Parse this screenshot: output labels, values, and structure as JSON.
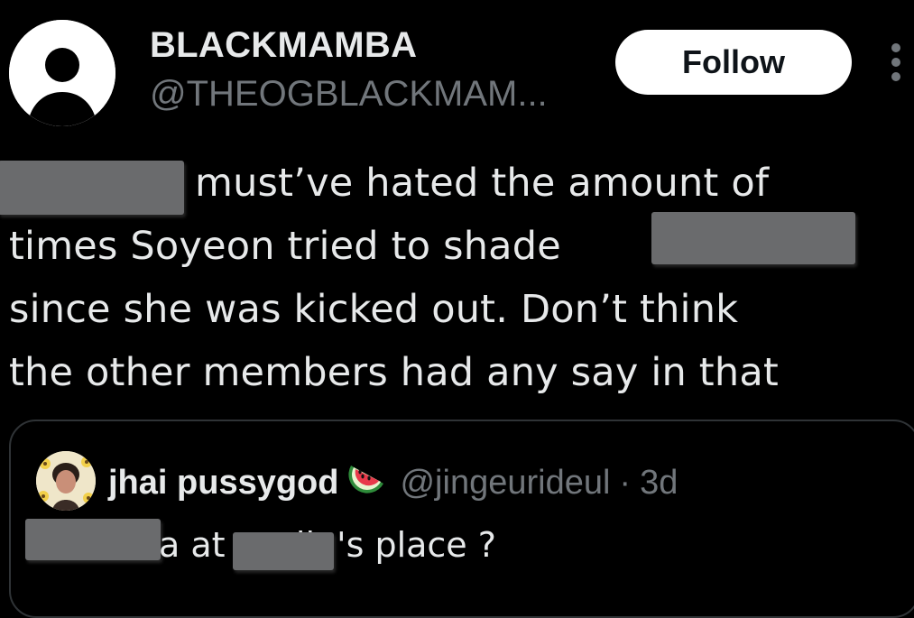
{
  "author": {
    "display_name": "BLACKMAMBA",
    "handle": "@THEOGBLACKMAM..."
  },
  "follow_label": "Follow",
  "tweet": {
    "lines": [
      "must’ve hated the amount of",
      "times Soyeon tried to shade",
      "since she was kicked out. Don’t think",
      "the other members had any say in that"
    ]
  },
  "quoted": {
    "display_name": "jhai pussygod",
    "emoji_icon": "watermelon-icon",
    "handle": "@jingeurideul",
    "separator": "·",
    "time": "3d",
    "text": "a at soojin's place  ?"
  },
  "colors": {
    "background": "#000000",
    "primary_text": "#e7e9ea",
    "secondary_text": "#71767b",
    "border": "#2f3336",
    "follow_bg": "#ffffff",
    "redaction": "#6a6b6d"
  }
}
